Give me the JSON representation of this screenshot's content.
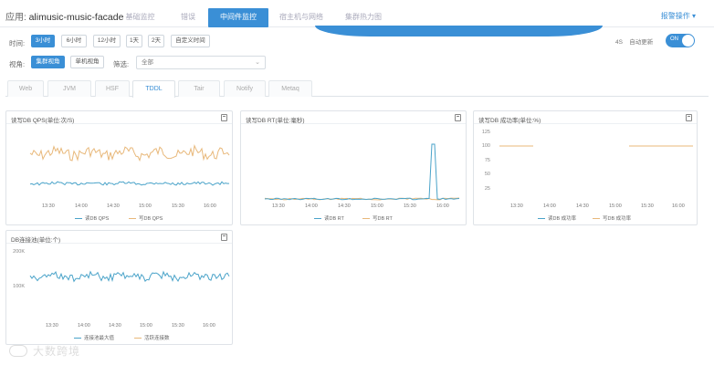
{
  "header": {
    "app_label": "应用:",
    "app_name": "alimusic-music-facade",
    "tabs": [
      {
        "label": "基础监控"
      },
      {
        "label": "错误"
      },
      {
        "label": "中间件监控"
      },
      {
        "label": "宿主机与网络"
      },
      {
        "label": "集群热力图"
      }
    ],
    "active_tab": 2,
    "alarm_label": "报警操作 ▾"
  },
  "filters": {
    "time_label": "时间:",
    "time_buttons": [
      "3小时",
      "6小时",
      "12小时",
      "1天",
      "2天",
      "自定义时间"
    ],
    "view_label": "视角:",
    "view_buttons": [
      "集群视角",
      "单机视角"
    ],
    "filter_label": "筛选:",
    "filter_value": "全部",
    "refresh_interval": "4S",
    "auto_refresh_label": "自动更新",
    "toggle_text": "ON"
  },
  "subtabs": [
    "Web",
    "JVM",
    "HSF",
    "TDDL",
    "Tair",
    "Notify",
    "Metaq"
  ],
  "active_subtab": 3,
  "panels": [
    {
      "title": "读写DB QPS(单位:次/S)",
      "x_ticks": [
        "13:30",
        "14:00",
        "14:30",
        "15:00",
        "15:30",
        "16:00"
      ],
      "legend": [
        "读DB QPS",
        "写DB QPS"
      ]
    },
    {
      "title": "读写DB RT(单位:毫秒)",
      "x_ticks": [
        "13:30",
        "14:00",
        "14:30",
        "15:00",
        "15:30",
        "16:00"
      ],
      "legend": [
        "读DB RT",
        "写DB RT"
      ]
    },
    {
      "title": "读写DB 成功率(单位:%)",
      "y_ticks": [
        "125",
        "100",
        "75",
        "50",
        "25"
      ],
      "x_ticks": [
        "13:30",
        "14:00",
        "14:30",
        "15:00",
        "15:30",
        "16:00"
      ],
      "legend": [
        "读DB 成功率",
        "写DB 成功率"
      ]
    },
    {
      "title": "DB连接池(单位:个)",
      "y_ticks": [
        "200K",
        "100K"
      ],
      "x_ticks": [
        "13:30",
        "14:00",
        "14:30",
        "15:00",
        "15:30",
        "16:00"
      ],
      "legend": [
        "连接池最大值",
        "活跃连接数"
      ]
    }
  ],
  "chart_data": [
    {
      "type": "line",
      "title": "读写DB QPS(单位:次/S)",
      "x": [
        "13:30",
        "14:00",
        "14:30",
        "15:00",
        "15:30",
        "16:00"
      ],
      "series": [
        {
          "name": "读DB QPS",
          "color": "#4aa3c9",
          "values": [
            1.0,
            1.0,
            1.0,
            1.0,
            1.0,
            1.0
          ]
        },
        {
          "name": "写DB QPS",
          "color": "#e8b87a",
          "values": [
            2.3,
            2.2,
            2.3,
            2.2,
            2.3,
            2.2
          ]
        }
      ]
    },
    {
      "type": "line",
      "title": "读写DB RT(单位:毫秒)",
      "x": [
        "13:30",
        "14:00",
        "14:30",
        "15:00",
        "15:30",
        "16:00"
      ],
      "series": [
        {
          "name": "读DB RT",
          "color": "#4aa3c9",
          "values": [
            0.2,
            0.2,
            0.2,
            0.2,
            0.2,
            0.2
          ],
          "spike_at": "15:50",
          "spike_value": 1.0
        },
        {
          "name": "写DB RT",
          "color": "#e8b87a",
          "values": [
            0.2,
            0.2,
            0.2,
            0.2,
            0.2,
            0.2
          ]
        }
      ]
    },
    {
      "type": "line",
      "title": "读写DB 成功率(单位:%)",
      "x": [
        "13:30",
        "14:00",
        "14:30",
        "15:00",
        "15:30",
        "16:00"
      ],
      "ylim": [
        0,
        125
      ],
      "series": [
        {
          "name": "读DB 成功率",
          "color": "#4aa3c9",
          "values": [
            100,
            100,
            null,
            null,
            100,
            100
          ]
        },
        {
          "name": "写DB 成功率",
          "color": "#e8b87a",
          "values": [
            100,
            100,
            null,
            null,
            100,
            100
          ]
        }
      ]
    },
    {
      "type": "line",
      "title": "DB连接池(单位:个)",
      "x": [
        "13:30",
        "14:00",
        "14:30",
        "15:00",
        "15:30",
        "16:00"
      ],
      "ylim": [
        0,
        220000
      ],
      "series": [
        {
          "name": "连接池最大值",
          "color": "#4aa3c9",
          "values": [
            140000,
            150000,
            145000,
            140000,
            145000,
            140000
          ]
        },
        {
          "name": "活跃连接数",
          "color": "#e8b87a",
          "values": [
            null,
            null,
            null,
            null,
            null,
            null
          ]
        }
      ]
    }
  ],
  "watermark": "大数跨境"
}
